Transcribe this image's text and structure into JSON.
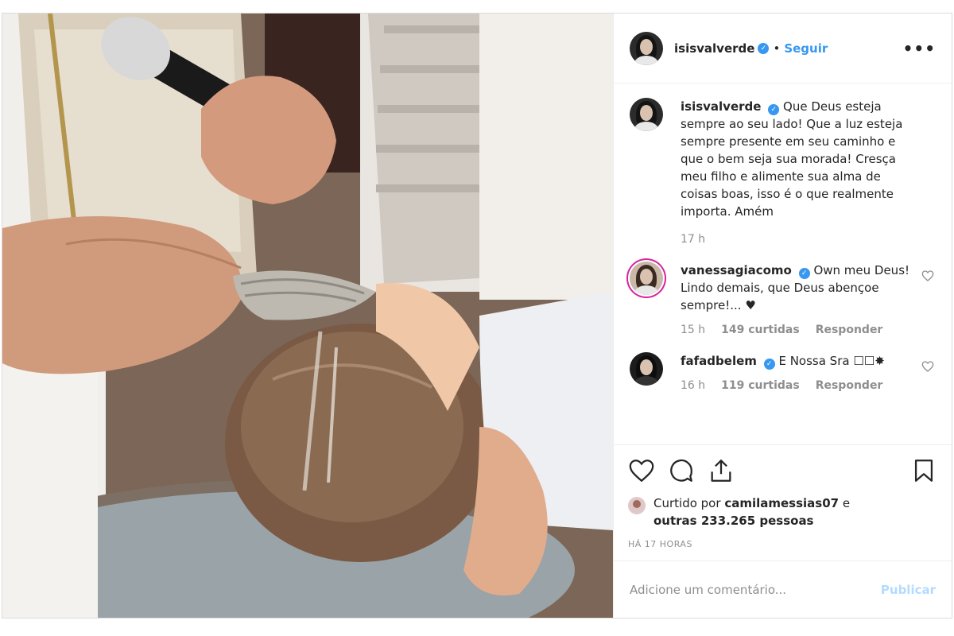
{
  "header": {
    "username": "isisvalverde",
    "separator": "•",
    "follow_label": "Seguir",
    "more_label": "•••"
  },
  "caption": {
    "username": "isisvalverde",
    "text": "Que Deus esteja sempre ao seu lado! Que a luz esteja sempre presente em seu caminho e que o bem seja sua morada! Cresça meu filho e alimente sua alma de coisas boas, isso é o que realmente importa. Amém",
    "time": "17 h"
  },
  "comments": [
    {
      "username": "vanessagiacomo",
      "text": "Own meu Deus! Lindo demais, que Deus abençoe sempre!... ♥",
      "time": "15 h",
      "likes": "149 curtidas",
      "reply": "Responder"
    },
    {
      "username": "fafadbelem",
      "text": "E Nossa Sra ☐☐✸",
      "time": "16 h",
      "likes": "119 curtidas",
      "reply": "Responder"
    }
  ],
  "likes": {
    "prefix": "Curtido por",
    "user": "camilamessias07",
    "mid": "e",
    "others": "outras 233.265 pessoas"
  },
  "timestamp": "HÁ 17 HORAS",
  "add_comment": {
    "placeholder": "Adicione um comentário...",
    "publish_label": "Publicar"
  },
  "colors": {
    "accent": "#3897f0",
    "publish_disabled": "#b3dbff",
    "meta": "#8e8e8e",
    "text": "#262626"
  },
  "icons": [
    "verified-badge-icon",
    "more-options-icon",
    "heart-icon",
    "comment-icon",
    "share-icon",
    "bookmark-icon"
  ]
}
